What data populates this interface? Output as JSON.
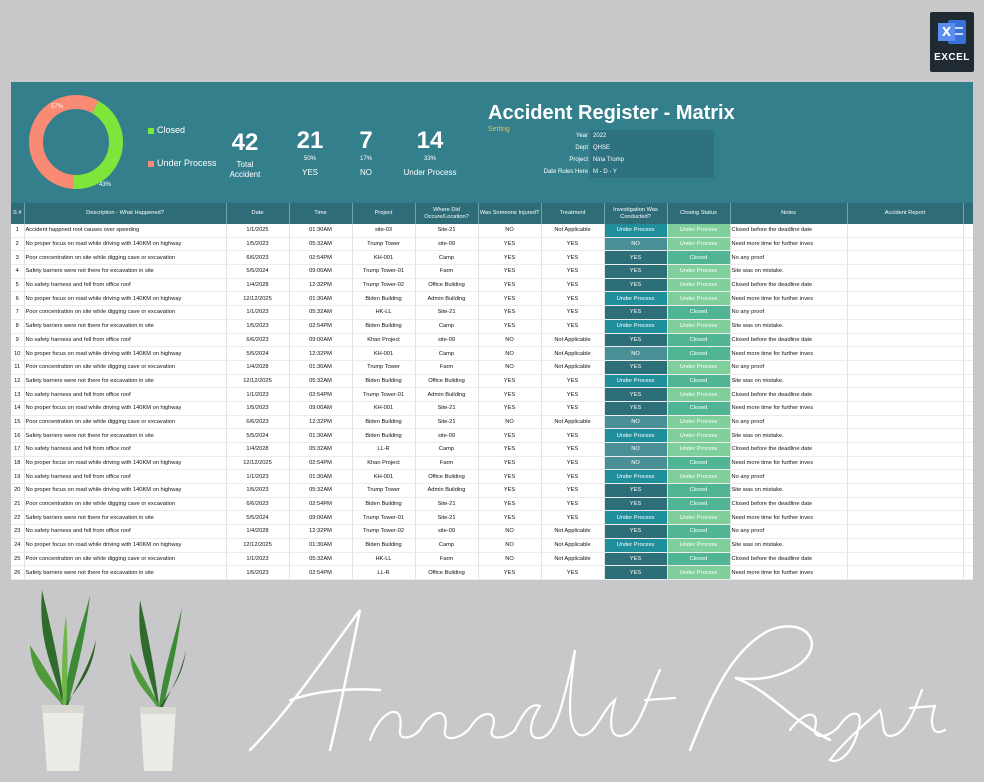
{
  "badge": {
    "label": "EXCEL",
    "icon": "excel-icon"
  },
  "dashboard": {
    "title": "Accident Register - Matrix",
    "setting_label": "Setting",
    "donut": {
      "closed_pct_label": "43%",
      "under_process_pct_label": "57%",
      "closed_fraction": 0.43,
      "colors": {
        "closed": "#7ee63a",
        "under_process": "#f98a74"
      }
    },
    "legend": {
      "closed": "Closed",
      "under_process": "Under Process"
    },
    "kpis": [
      {
        "num": "42",
        "pct": "",
        "label": "Total Accident"
      },
      {
        "num": "21",
        "pct": "50%",
        "label": "YES"
      },
      {
        "num": "7",
        "pct": "17%",
        "label": "NO"
      },
      {
        "num": "14",
        "pct": "33%",
        "label": "Under Process"
      }
    ],
    "info": [
      {
        "k": "Year",
        "v": "2022"
      },
      {
        "k": "Dept",
        "v": "QHSE"
      },
      {
        "k": "Project",
        "v": "Nina Trump"
      },
      {
        "k": "Date Rules Here",
        "v": "M - D - Y"
      }
    ]
  },
  "table": {
    "headers": [
      "S #",
      "Description - What Happened?",
      "Date",
      "Time",
      "Project",
      "Where Did Occure/Location?",
      "Was Someone Injured?",
      "Treatment",
      "Investigation Was Conducted?",
      "Closing Status",
      "Notes",
      "Accident Report"
    ],
    "rows": [
      [
        "1",
        "Accident happned root causes over speeding",
        "1/1/2025",
        "01:30AM",
        "site-03",
        "Site-21",
        "NO",
        "Not Applicable",
        "Under Process",
        "Under Process",
        "Closed before the deadline date"
      ],
      [
        "2",
        "No proper focus on road while driving with 140KM on highway",
        "1/5/2023",
        "05:32AM",
        "Trump Tower",
        "site-09",
        "YES",
        "YES",
        "NO",
        "Under Process",
        "Need more time for further inves"
      ],
      [
        "3",
        "Poor concentration on site while digging cave or excavation",
        "6/6/2023",
        "02:54PM",
        "KH-001",
        "Camp",
        "YES",
        "YES",
        "YES",
        "Closed",
        "No any proof"
      ],
      [
        "4",
        "Safety barriers were not there for excavation in site",
        "5/5/2024",
        "09:00AM",
        "Trump Tower-01",
        "Farm",
        "YES",
        "YES",
        "YES",
        "Under Process",
        "Site was on mistake."
      ],
      [
        "5",
        "No safety harness and fell from office roof",
        "1/4/2028",
        "12:32PM",
        "Trump Tower-02",
        "Office Building",
        "YES",
        "YES",
        "YES",
        "Under Process",
        "Closed before the deadline date"
      ],
      [
        "6",
        "No proper focus on road while driving with 140KM on highway",
        "12/12/2025",
        "01:30AM",
        "Biden Building",
        "Admin Building",
        "YES",
        "YES",
        "Under Process",
        "Under Process",
        "Need more time for further inves"
      ],
      [
        "7",
        "Poor concentration on site while digging cave or excavation",
        "1/1/2023",
        "05:32AM",
        "HK-LL",
        "Site-21",
        "YES",
        "YES",
        "YES",
        "Closed",
        "No any proof"
      ],
      [
        "8",
        "Safety barriers were not there for excavation in site",
        "1/5/2023",
        "02:54PM",
        "Biden Building",
        "Camp",
        "YES",
        "YES",
        "Under Process",
        "Under Process",
        "Site was on mistake."
      ],
      [
        "9",
        "No safety harness and fell from office roof",
        "6/6/2023",
        "09:00AM",
        "Khan Project",
        "site-09",
        "NO",
        "Not Applicable",
        "YES",
        "Closed",
        "Closed before the deadline date"
      ],
      [
        "10",
        "No proper focus on road while driving with 140KM on highway",
        "5/5/2024",
        "12:32PM",
        "KH-001",
        "Camp",
        "NO",
        "Not Applicable",
        "NO",
        "Closed",
        "Need more time for further inves"
      ],
      [
        "11",
        "Poor concentration on site while digging cave or excavation",
        "1/4/2028",
        "01:30AM",
        "Trump Tower",
        "Farm",
        "NO",
        "Not Applicable",
        "YES",
        "Under Process",
        "No any proof"
      ],
      [
        "12",
        "Safety barriers were not there for excavation in site",
        "12/12/2025",
        "05:32AM",
        "Biden Building",
        "Office Building",
        "YES",
        "YES",
        "Under Process",
        "Closed",
        "Site was on mistake."
      ],
      [
        "13",
        "No safety harness and fell from office roof",
        "1/1/2023",
        "02:54PM",
        "Trump Tower-01",
        "Admin Building",
        "YES",
        "YES",
        "YES",
        "Under Process",
        "Closed before the deadline date"
      ],
      [
        "14",
        "No proper focus on road while driving with 140KM on highway",
        "1/5/2023",
        "09:00AM",
        "KH-001",
        "Site-21",
        "YES",
        "YES",
        "YES",
        "Closed",
        "Need more time for further inves"
      ],
      [
        "15",
        "Poor concentration on site while digging cave or excavation",
        "6/6/2023",
        "12:32PM",
        "Biden Building",
        "Site-21",
        "NO",
        "Not Applicable",
        "NO",
        "Under Process",
        "No any proof"
      ],
      [
        "16",
        "Safety barriers were not there for excavation in site",
        "5/5/2024",
        "01:30AM",
        "Biden Building",
        "site-09",
        "YES",
        "YES",
        "Under Process",
        "Under Process",
        "Site was on mistake."
      ],
      [
        "17",
        "No safety harness and fell from office roof",
        "1/4/2028",
        "05:32AM",
        "LL-R",
        "Camp",
        "YES",
        "YES",
        "NO",
        "Under Process",
        "Closed before the deadline date"
      ],
      [
        "18",
        "No proper focus on road while driving with 140KM on highway",
        "12/12/2025",
        "02:54PM",
        "Khan Project",
        "Farm",
        "YES",
        "YES",
        "NO",
        "Closed",
        "Need more time for further inves"
      ],
      [
        "19",
        "No safety harness and fell from office roof",
        "1/1/2023",
        "01:30AM",
        "KH-001",
        "Office Building",
        "YES",
        "YES",
        "Under Process",
        "Under Process",
        "No any proof"
      ],
      [
        "20",
        "No proper focus on road while driving with 140KM on highway",
        "1/5/2023",
        "05:32AM",
        "Trump Tower",
        "Admin Building",
        "YES",
        "YES",
        "YES",
        "Closed",
        "Site was on mistake."
      ],
      [
        "21",
        "Poor concentration on site while digging cave or excavation",
        "6/6/2023",
        "02:54PM",
        "Biden Building",
        "Site-21",
        "YES",
        "YES",
        "YES",
        "Closed",
        "Closed before the deadline date"
      ],
      [
        "22",
        "Safety barriers were not there for excavation in site",
        "5/5/2024",
        "09:00AM",
        "Trump Tower-01",
        "Site-21",
        "YES",
        "YES",
        "Under Process",
        "Under Process",
        "Need more time for further inves"
      ],
      [
        "23",
        "No safety harness and fell from office roof",
        "1/4/2028",
        "12:32PM",
        "Trump Tower-02",
        "site-09",
        "NO",
        "Not Applicable",
        "YES",
        "Closed",
        "No any proof"
      ],
      [
        "24",
        "No proper focus on road while driving with 140KM on highway",
        "12/12/2025",
        "01:30AM",
        "Biden Building",
        "Camp",
        "NO",
        "Not Applicable",
        "Under Process",
        "Under Process",
        "Site was on mistake."
      ],
      [
        "25",
        "Poor concentration on site while digging cave or excavation",
        "1/1/2023",
        "05:32AM",
        "HK-LL",
        "Farm",
        "NO",
        "Not Applicable",
        "YES",
        "Closed",
        "Closed before the deadline date"
      ],
      [
        "26",
        "Safety barriers were not there for excavation in site",
        "1/5/2023",
        "02:54PM",
        "LL-R",
        "Office Building",
        "YES",
        "YES",
        "YES",
        "Under Process",
        "Need more time for further inves"
      ],
      [
        "27",
        "No safety harness and fell from office roof",
        "6/6/2023",
        "09:00AM",
        "Khan Project",
        "Admin Building",
        "YES",
        "YES",
        "YES",
        "Under Process",
        "No any proof"
      ],
      [
        "28",
        "No proper focus on road while driving with 140KM on highway",
        "5/5/2024",
        "12:32PM",
        "KH-001",
        "Site-21",
        "YES",
        "YES",
        "Under Process",
        "Under Process",
        "Site was on mistake."
      ]
    ]
  },
  "signature_text": "Accident Register"
}
